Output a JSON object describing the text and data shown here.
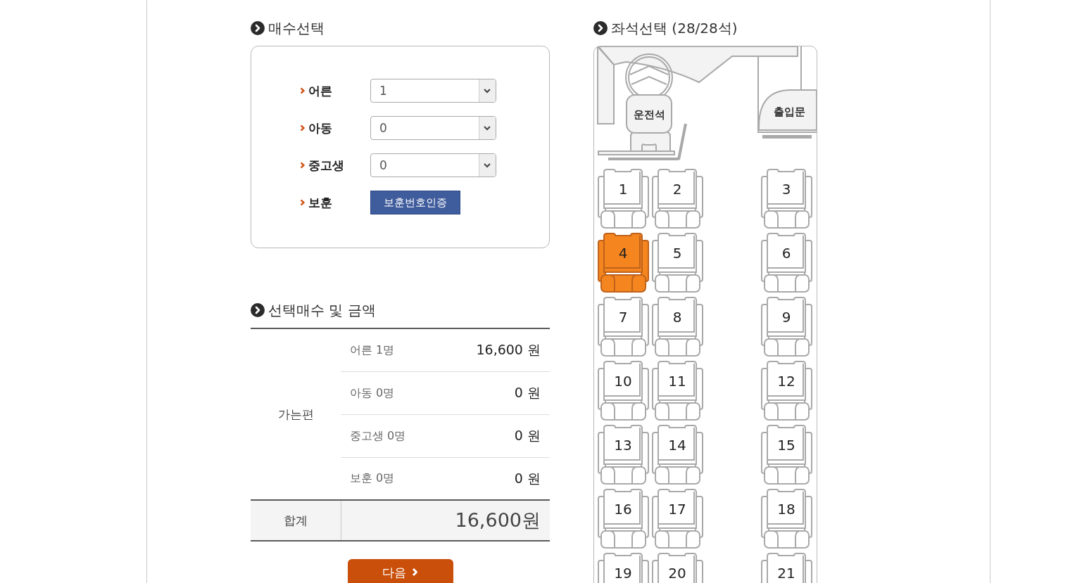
{
  "ticket_count": {
    "title": "매수선택",
    "rows": [
      {
        "kind": "select",
        "label": "어른",
        "value": "1"
      },
      {
        "kind": "select",
        "label": "아동",
        "value": "0"
      },
      {
        "kind": "select",
        "label": "중고생",
        "value": "0"
      },
      {
        "kind": "button",
        "label": "보훈",
        "button": "보훈번호인증"
      }
    ]
  },
  "summary": {
    "title": "선택매수 및 금액",
    "direction": "가는편",
    "lines": [
      {
        "label": "어른 1명",
        "amount": "16,600 원"
      },
      {
        "label": "아동 0명",
        "amount": "0 원"
      },
      {
        "label": "중고생 0명",
        "amount": "0 원"
      },
      {
        "label": "보훈 0명",
        "amount": "0 원"
      }
    ],
    "total_label": "합계",
    "total": "16,600원"
  },
  "next_button": "다음",
  "seat_map": {
    "title": "좌석선택 (28/28석)",
    "driver_label": "운전석",
    "door_label": "출입문",
    "seats": [
      {
        "number": "1",
        "selected": false
      },
      {
        "number": "2",
        "selected": false
      },
      {
        "number": "3",
        "selected": false
      },
      {
        "number": "4",
        "selected": true
      },
      {
        "number": "5",
        "selected": false
      },
      {
        "number": "6",
        "selected": false
      },
      {
        "number": "7",
        "selected": false
      },
      {
        "number": "8",
        "selected": false
      },
      {
        "number": "9",
        "selected": false
      },
      {
        "number": "10",
        "selected": false
      },
      {
        "number": "11",
        "selected": false
      },
      {
        "number": "12",
        "selected": false
      },
      {
        "number": "13",
        "selected": false
      },
      {
        "number": "14",
        "selected": false
      },
      {
        "number": "15",
        "selected": false
      },
      {
        "number": "16",
        "selected": false
      },
      {
        "number": "17",
        "selected": false
      },
      {
        "number": "18",
        "selected": false
      },
      {
        "number": "19",
        "selected": false
      },
      {
        "number": "20",
        "selected": false
      },
      {
        "number": "21",
        "selected": false
      }
    ]
  }
}
